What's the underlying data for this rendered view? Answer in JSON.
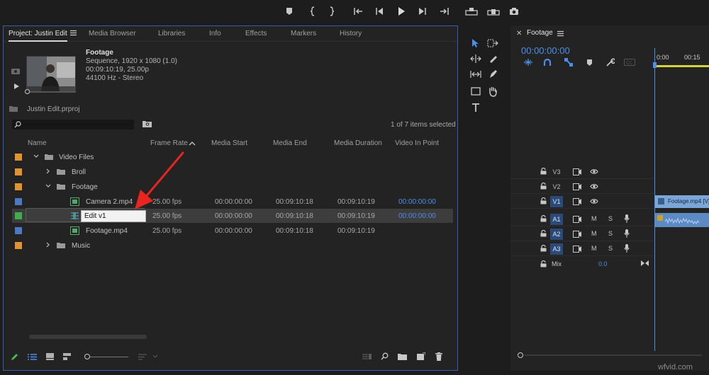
{
  "project_panel": {
    "tabs": [
      {
        "label": "Project: Justin Edit"
      },
      {
        "label": "Media Browser"
      },
      {
        "label": "Libraries"
      },
      {
        "label": "Info"
      },
      {
        "label": "Effects"
      },
      {
        "label": "Markers"
      },
      {
        "label": "History"
      }
    ],
    "preview": {
      "title": "Footage",
      "line1": "Sequence, 1920 x 1080 (1.0)",
      "line2": "00:09:10:19, 25.00p",
      "line3": "44100 Hz - Stereo"
    },
    "project_file": "Justin Edit.prproj",
    "items_selected": "1 of 7 items selected",
    "columns": [
      "Name",
      "Frame Rate",
      "Media Start",
      "Media End",
      "Media Duration",
      "Video In Point"
    ],
    "rows": [
      {
        "name": "Video Files",
        "color": "#e0932f",
        "frame_rate": "",
        "media_start": "",
        "media_end": "",
        "media_duration": "",
        "video_in": ""
      },
      {
        "name": "Broll",
        "color": "#e0932f",
        "frame_rate": "",
        "media_start": "",
        "media_end": "",
        "media_duration": "",
        "video_in": ""
      },
      {
        "name": "Footage",
        "color": "#e0932f",
        "frame_rate": "",
        "media_start": "",
        "media_end": "",
        "media_duration": "",
        "video_in": ""
      },
      {
        "name": "Camera 2.mp4",
        "color": "#4e78c4",
        "frame_rate": "25.00 fps",
        "media_start": "00:00:00:00",
        "media_end": "00:09:10:18",
        "media_duration": "00:09:10:19",
        "video_in": "00:00:00:00"
      },
      {
        "name": "",
        "color": "#3fae49",
        "frame_rate": "25.00 fps",
        "media_start": "00:00:00:00",
        "media_end": "00:09:10:18",
        "media_duration": "00:09:10:19",
        "video_in": "00:00:00:00"
      },
      {
        "name": "Footage.mp4",
        "color": "#4e78c4",
        "frame_rate": "25.00 fps",
        "media_start": "00:00:00:00",
        "media_end": "00:09:10:18",
        "media_duration": "00:09:10:19",
        "video_in": ""
      },
      {
        "name": "Music",
        "color": "#e0932f",
        "frame_rate": "",
        "media_start": "",
        "media_end": "",
        "media_duration": "",
        "video_in": ""
      }
    ],
    "rename_value": "Edit v1"
  },
  "timeline": {
    "title": "Footage",
    "timecode": "00:00:00:00",
    "ruler": [
      "0:00",
      "00:15"
    ],
    "tracks": [
      {
        "name": "V3",
        "on": false
      },
      {
        "name": "V2",
        "on": false
      },
      {
        "name": "V1",
        "on": true
      },
      {
        "name": "A1",
        "on": true
      },
      {
        "name": "A2",
        "on": true
      },
      {
        "name": "A3",
        "on": true
      }
    ],
    "mute_label": "M",
    "solo_label": "S",
    "mix_label": "Mix",
    "mix_value": "0.0",
    "clip_label": "Footage.mp4 [V]"
  },
  "watermark": "wfvid.com",
  "colors": {
    "accent": "#3c5cb0",
    "timecode": "#4c8fe8",
    "arrow": "#e8251f"
  }
}
